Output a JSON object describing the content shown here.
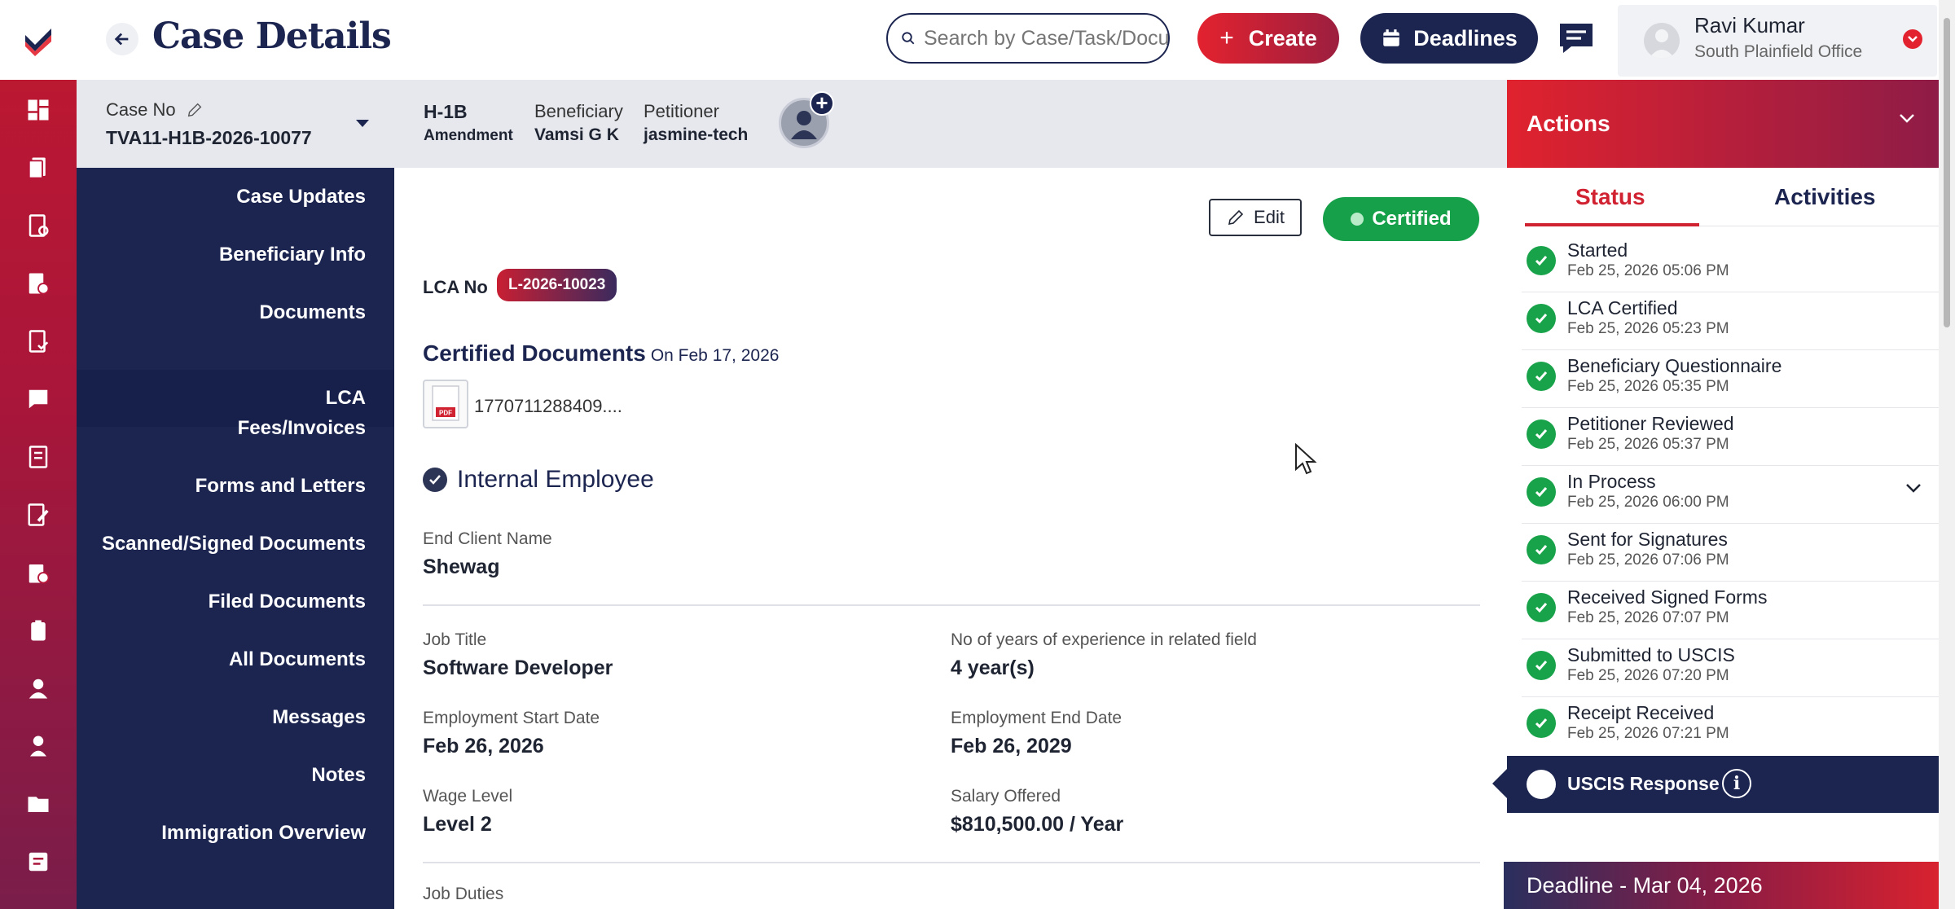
{
  "colors": {
    "brand_navy": "#1c2550",
    "brand_red": "#e3222f",
    "success_green": "#18a34a"
  },
  "header": {
    "title": "Case Details",
    "search_placeholder": "Search by Case/Task/Document",
    "create_label": "Create",
    "deadlines_label": "Deadlines",
    "user": {
      "name": "Ravi Kumar",
      "office": "South Plainfield Office"
    }
  },
  "case_bar": {
    "case_no_label": "Case No",
    "case_no": "TVA11-H1B-2026-10077",
    "visa_type": "H-1B",
    "visa_subtype": "Amendment",
    "beneficiary_label": "Beneficiary",
    "beneficiary": "Vamsi G K",
    "petitioner_label": "Petitioner",
    "petitioner": "jasmine-tech"
  },
  "left_nav": {
    "active": "LCA",
    "items": [
      "Case Updates",
      "Beneficiary Info",
      "Documents",
      "LCA",
      "Fees/Invoices",
      "Forms and Letters",
      "Scanned/Signed Documents",
      "Filed Documents",
      "All Documents",
      "Messages",
      "Notes",
      "Immigration Overview"
    ]
  },
  "rail_icons": [
    "dashboard-icon",
    "cases-icon",
    "tasks-icon",
    "invoices-icon",
    "checklist-icon",
    "messages-icon",
    "documents-icon",
    "forms-icon",
    "approvals-icon",
    "clipboard-icon",
    "beneficiary-icon",
    "users-icon",
    "folder-icon",
    "notes-icon"
  ],
  "main": {
    "edit_label": "Edit",
    "status_badge": "Certified",
    "lca_no_label": "LCA No",
    "lca_no": "L-2026-10023",
    "certified_docs_title": "Certified Documents",
    "certified_docs_on": "On Feb 17, 2026",
    "file_name": "1770711288409....",
    "file_type": "PDF",
    "employee_type": "Internal Employee",
    "fields": {
      "end_client_label": "End Client Name",
      "end_client": "Shewag",
      "job_title_label": "Job Title",
      "job_title": "Software Developer",
      "experience_label": "No of years of experience in related field",
      "experience": "4 year(s)",
      "start_date_label": "Employment Start Date",
      "start_date": "Feb 26, 2026",
      "end_date_label": "Employment End Date",
      "end_date": "Feb 26, 2029",
      "wage_level_label": "Wage Level",
      "wage_level": "Level 2",
      "salary_label": "Salary Offered",
      "salary": "$810,500.00 / Year",
      "job_duties_label": "Job Duties"
    }
  },
  "right_panel": {
    "title": "Actions",
    "tabs": [
      "Status",
      "Activities"
    ],
    "active_tab": "Status",
    "steps": [
      {
        "name": "Started",
        "date": "Feb 25, 2026 05:06 PM"
      },
      {
        "name": "LCA Certified",
        "date": "Feb 25, 2026 05:23 PM"
      },
      {
        "name": "Beneficiary Questionnaire",
        "date": "Feb 25, 2026 05:35 PM"
      },
      {
        "name": "Petitioner Reviewed",
        "date": "Feb 25, 2026 05:37 PM"
      },
      {
        "name": "In Process",
        "date": "Feb 25, 2026 06:00 PM"
      },
      {
        "name": "Sent for Signatures",
        "date": "Feb 25, 2026 07:06 PM"
      },
      {
        "name": "Received Signed Forms",
        "date": "Feb 25, 2026 07:07 PM"
      },
      {
        "name": "Submitted to USCIS",
        "date": "Feb 25, 2026 07:20 PM"
      },
      {
        "name": "Receipt Received",
        "date": "Feb 25, 2026 07:21 PM"
      }
    ],
    "current_step": "USCIS Response",
    "deadline": "Deadline - Mar 04, 2026"
  }
}
